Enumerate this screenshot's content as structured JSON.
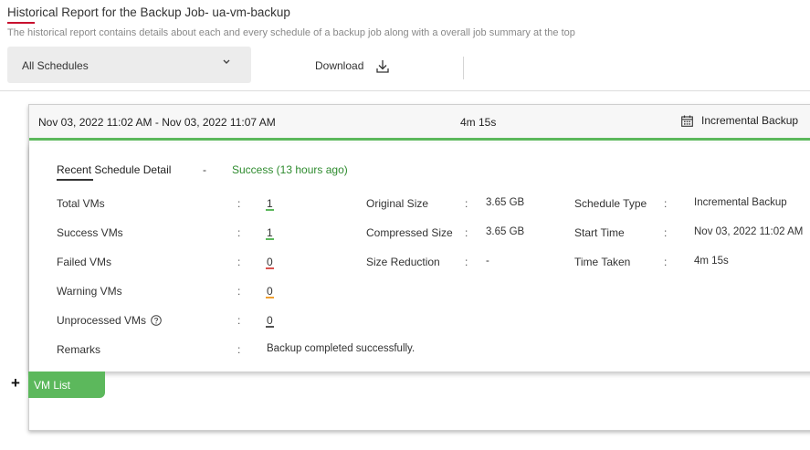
{
  "page": {
    "title": "Historical Report for the Backup Job- ua-vm-backup",
    "subtitle": "The historical report contains details about each and every schedule of a backup job along with a overall job summary at the top"
  },
  "toolbar": {
    "schedule_select": "All Schedules",
    "download_label": "Download"
  },
  "schedule": {
    "range": "Nov 03, 2022 11:02 AM - Nov 03, 2022 11:07 AM",
    "duration": "4m 15s",
    "type": "Incremental Backup"
  },
  "detail": {
    "title": "Recent Schedule Detail",
    "dash": "-",
    "status": "Success (13 hours ago)",
    "colon": ":",
    "left": [
      {
        "label": "Total VMs",
        "value": "1"
      },
      {
        "label": "Success VMs",
        "value": "1"
      },
      {
        "label": "Failed VMs",
        "value": "0"
      },
      {
        "label": "Warning VMs",
        "value": "0"
      },
      {
        "label": "Unprocessed VMs",
        "value": "0"
      }
    ],
    "remarks": {
      "label": "Remarks",
      "value": "Backup completed successfully."
    },
    "middle": [
      {
        "label": "Original Size",
        "value": "3.65 GB"
      },
      {
        "label": "Compressed Size",
        "value": "3.65 GB"
      },
      {
        "label": "Size Reduction",
        "value": "-"
      }
    ],
    "right": [
      {
        "label": "Schedule Type",
        "value": "Incremental Backup"
      },
      {
        "label": "Start Time",
        "value": "Nov 03, 2022 11:02 AM"
      },
      {
        "label": "Time Taken",
        "value": "4m 15s"
      }
    ]
  },
  "vm_list": {
    "expand_symbol": "+",
    "label": "VM List"
  },
  "colors": {
    "accent_green": "#5cb85c",
    "status_green": "#2e8b2e",
    "title_red": "#c8102e",
    "failed_red": "#d9534f",
    "warning_orange": "#f0a030"
  }
}
